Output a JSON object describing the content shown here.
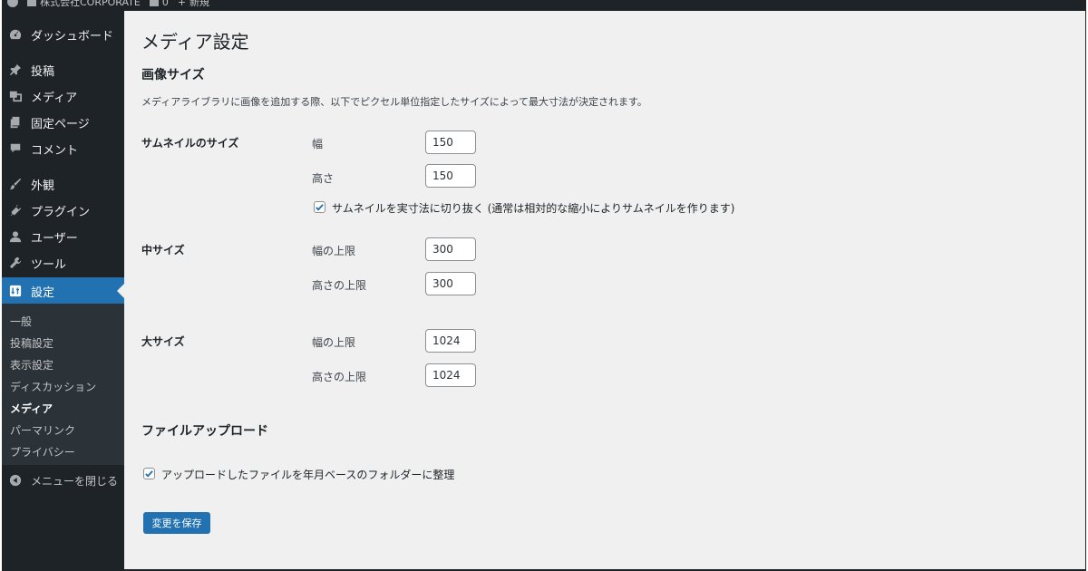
{
  "adminbar": {
    "site_name": "株式会社CORPORATE",
    "comments_count": "0",
    "new_label": "新規"
  },
  "sidebar": {
    "items": [
      {
        "label": "ダッシュボード",
        "icon": "dashboard-icon"
      },
      {
        "label": "投稿",
        "icon": "pin-icon"
      },
      {
        "label": "メディア",
        "icon": "media-icon"
      },
      {
        "label": "固定ページ",
        "icon": "page-icon"
      },
      {
        "label": "コメント",
        "icon": "comment-icon"
      },
      {
        "label": "外観",
        "icon": "brush-icon"
      },
      {
        "label": "プラグイン",
        "icon": "plugin-icon"
      },
      {
        "label": "ユーザー",
        "icon": "user-icon"
      },
      {
        "label": "ツール",
        "icon": "wrench-icon"
      },
      {
        "label": "設定",
        "icon": "settings-icon"
      }
    ],
    "submenu": [
      "一般",
      "投稿設定",
      "表示設定",
      "ディスカッション",
      "メディア",
      "パーマリンク",
      "プライバシー"
    ],
    "collapse_label": "メニューを閉じる"
  },
  "page": {
    "title": "メディア設定",
    "image_sizes_heading": "画像サイズ",
    "image_sizes_desc": "メディアライブラリに画像を追加する際、以下でピクセル単位指定したサイズによって最大寸法が決定されます。",
    "thumbnail": {
      "label": "サムネイルのサイズ",
      "width_label": "幅",
      "width": "150",
      "height_label": "高さ",
      "height": "150",
      "crop_label": "サムネイルを実寸法に切り抜く (通常は相対的な縮小によりサムネイルを作ります)",
      "crop_checked": true
    },
    "medium": {
      "label": "中サイズ",
      "width_label": "幅の上限",
      "width": "300",
      "height_label": "高さの上限",
      "height": "300"
    },
    "large": {
      "label": "大サイズ",
      "width_label": "幅の上限",
      "width": "1024",
      "height_label": "高さの上限",
      "height": "1024"
    },
    "uploads_heading": "ファイルアップロード",
    "uploads_label": "アップロードしたファイルを年月ベースのフォルダーに整理",
    "uploads_checked": true,
    "save_label": "変更を保存"
  },
  "colors": {
    "sidebar_bg": "#1d2327",
    "accent": "#2271b1",
    "content_bg": "#f0f0f1"
  }
}
